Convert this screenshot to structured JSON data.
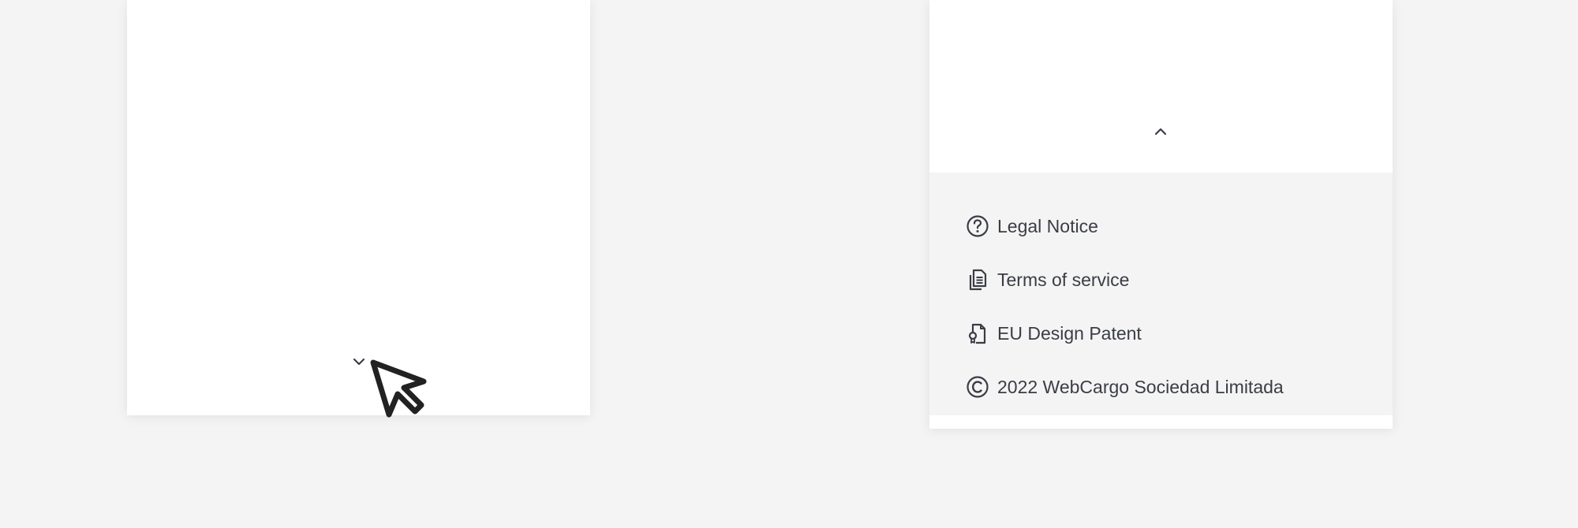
{
  "left_panel": {
    "toggle_icon": "chevron-down-icon"
  },
  "right_panel": {
    "toggle_icon": "chevron-up-icon",
    "menu": [
      {
        "icon": "question-circle-icon",
        "label": "Legal Notice"
      },
      {
        "icon": "document-icon",
        "label": "Terms of service"
      },
      {
        "icon": "patent-document-icon",
        "label": "EU Design Patent"
      },
      {
        "icon": "copyright-icon",
        "label": "2022 WebCargo Sociedad Limitada"
      }
    ]
  },
  "colors": {
    "background": "#f4f4f4",
    "panel": "#ffffff",
    "text": "#3b3d45",
    "icon": "#3b3d45"
  }
}
